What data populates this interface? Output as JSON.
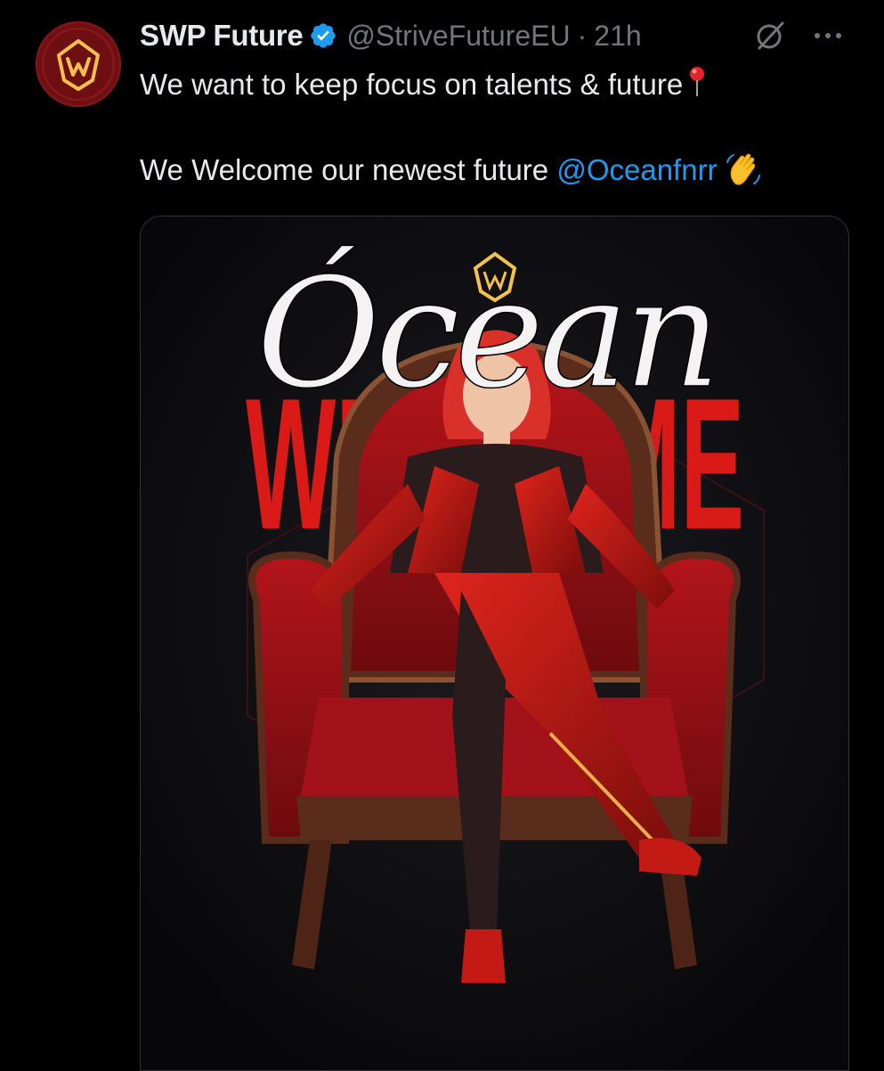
{
  "tweet": {
    "author_name": "SWP Future",
    "handle": "@StriveFutureEU",
    "separator": "·",
    "time": "21h",
    "line1": "We want to keep focus on talents & future",
    "line2_prefix": "We Welcome our newest future",
    "mention": "@Oceanfnrr"
  },
  "media": {
    "overlay_name": "Ócean",
    "banner_text": "WELCOME"
  },
  "icons": {
    "verified": "verified-badge-icon",
    "grok": "grok-icon",
    "more": "more-options-icon",
    "pin": "round-pushpin-emoji",
    "wave": "waving-hand-emoji"
  },
  "colors": {
    "background": "#000000",
    "text": "#e7e9ea",
    "secondary": "#71767b",
    "link": "#1d9bf0",
    "brand_red": "#d91a17",
    "avatar_gold": "#f3c24a"
  }
}
